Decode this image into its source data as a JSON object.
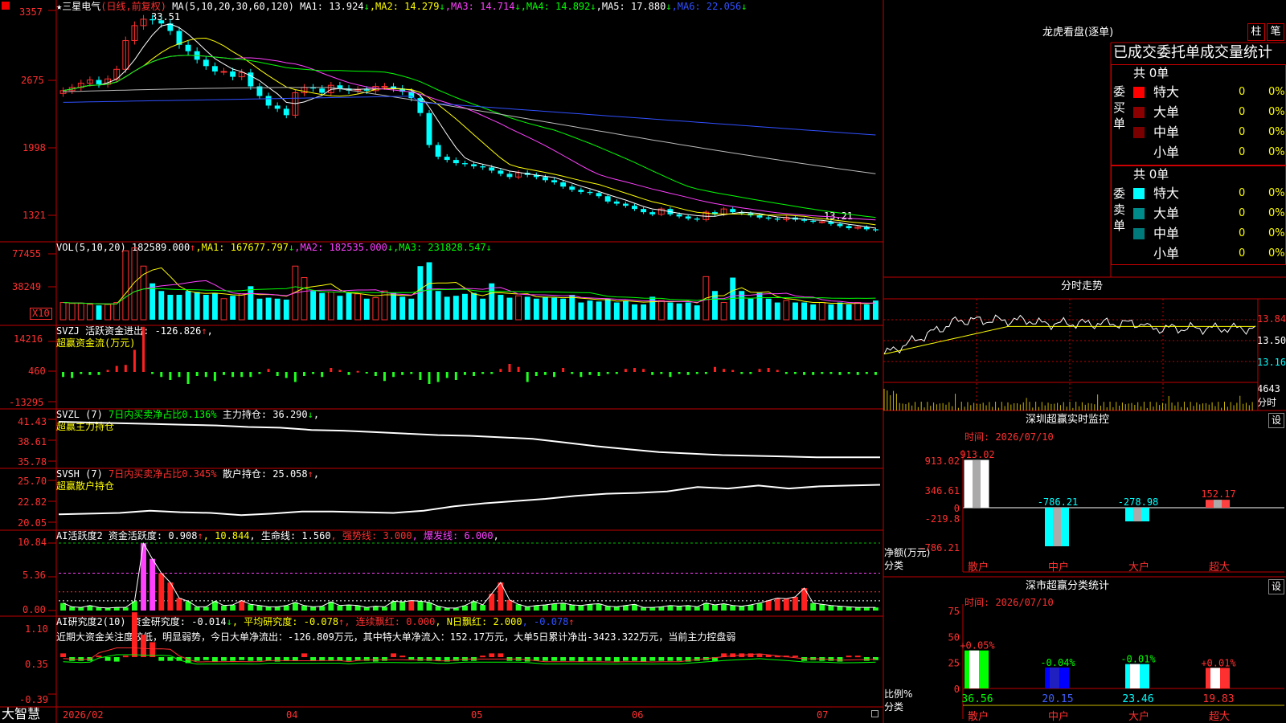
{
  "stock": {
    "name": "三星电气",
    "period": "日线",
    "adjust": "前复权",
    "high_label": "33.51",
    "low_label": "13.21"
  },
  "axis_labels": {
    "price": [
      "3357",
      "2675",
      "1998",
      "1321"
    ],
    "vol": [
      "77455",
      "38249"
    ],
    "vol_unit": "X10",
    "svzj": [
      "14216",
      "460",
      "-13295"
    ],
    "svzl": [
      "41.43",
      "38.61",
      "35.78"
    ],
    "svsh": [
      "25.70",
      "22.82",
      "20.05"
    ],
    "ai1": [
      "10.84",
      "5.36",
      "0.00"
    ],
    "ai2": [
      "1.10",
      "0.35",
      "-0.39"
    ]
  },
  "headers": {
    "price": [
      {
        "t": "★",
        "c": "#ffffff"
      },
      {
        "t": "三星电气",
        "c": "#ffffff"
      },
      {
        "t": "(日线,前复权)",
        "c": "#ff3030"
      },
      {
        "t": " MA(5,10,20,30,60,120) MA1: 13.924",
        "c": "#ffffff"
      },
      {
        "t": "↓",
        "c": "#00ff00"
      },
      {
        "t": ",MA2: 14.279",
        "c": "#ffff00"
      },
      {
        "t": "↓",
        "c": "#00ff00"
      },
      {
        "t": ",MA3: 14.714",
        "c": "#ff40ff"
      },
      {
        "t": "↓",
        "c": "#00ff00"
      },
      {
        "t": ",MA4: 14.892",
        "c": "#00ff00"
      },
      {
        "t": "↓",
        "c": "#00ff00"
      },
      {
        "t": ",MA5: 17.880",
        "c": "#ffffff"
      },
      {
        "t": "↓",
        "c": "#00ff00"
      },
      {
        "t": ",MA6: 22.056",
        "c": "#3050ff"
      },
      {
        "t": "↓",
        "c": "#00ff00"
      }
    ],
    "vol": [
      {
        "t": "VOL(5,10,20) 182589.000",
        "c": "#ffffff"
      },
      {
        "t": "↑",
        "c": "#ff3030"
      },
      {
        "t": ",MA1: 167677.797",
        "c": "#ffff00"
      },
      {
        "t": "↓",
        "c": "#00ff00"
      },
      {
        "t": ",MA2: 182535.000",
        "c": "#ff40ff"
      },
      {
        "t": "↓",
        "c": "#00ff00"
      },
      {
        "t": ",MA3: 231828.547",
        "c": "#00ff00"
      },
      {
        "t": "↓",
        "c": "#00ff00"
      }
    ],
    "svzj": [
      {
        "t": "SVZJ  活跃资金进出: -126.826",
        "c": "#ffffff"
      },
      {
        "t": "↑",
        "c": "#ff3030"
      },
      {
        "t": ",",
        "c": "#ffffff"
      }
    ],
    "svzj2": [
      {
        "t": "超赢资金流(万元)",
        "c": "#ffff00"
      }
    ],
    "svzl": [
      {
        "t": "SVZL (7) ",
        "c": "#ffffff"
      },
      {
        "t": "7日内买卖净占比0.136%",
        "c": "#00ff00"
      },
      {
        "t": " 主力持仓: 36.290",
        "c": "#ffffff"
      },
      {
        "t": "↓",
        "c": "#00ff00"
      },
      {
        "t": ",",
        "c": "#ffffff"
      }
    ],
    "svzl2": [
      {
        "t": "超赢主力持仓",
        "c": "#ffff00"
      }
    ],
    "svsh": [
      {
        "t": "SVSH (7) ",
        "c": "#ffffff"
      },
      {
        "t": "7日内买卖净占比0.345%",
        "c": "#ff3030"
      },
      {
        "t": " 散户持仓: 25.058",
        "c": "#ffffff"
      },
      {
        "t": "↑",
        "c": "#ff3030"
      },
      {
        "t": ",",
        "c": "#ffffff"
      }
    ],
    "svsh2": [
      {
        "t": "超赢散户持仓",
        "c": "#ffff00"
      }
    ],
    "ai1": [
      {
        "t": "AI活跃度2 资金活跃度: 0.908",
        "c": "#ffffff"
      },
      {
        "t": "↑",
        "c": "#ff3030"
      },
      {
        "t": ", 10.844",
        "c": "#ffff00"
      },
      {
        "t": ", 生命线: 1.560",
        "c": "#ffffff"
      },
      {
        "t": ", 强势线: 3.000",
        "c": "#ff3030"
      },
      {
        "t": ", 爆发线: 6.000",
        "c": "#ff40ff"
      },
      {
        "t": ",",
        "c": "#ffffff"
      }
    ],
    "ai2": [
      {
        "t": "AI研究度2(10) 资金研究度: -0.014",
        "c": "#ffffff"
      },
      {
        "t": "↓",
        "c": "#00ff00"
      },
      {
        "t": ", 平均研究度: -0.078",
        "c": "#ffff00"
      },
      {
        "t": "↑",
        "c": "#ff3030"
      },
      {
        "t": ", 连续飘红: 0.000",
        "c": "#ff3030"
      },
      {
        "t": ", N日飘红: 2.000",
        "c": "#ffff00"
      },
      {
        "t": ", -0.078",
        "c": "#3050ff"
      },
      {
        "t": "↑",
        "c": "#ff3030"
      }
    ],
    "ai2_text": "近期大资金关注度较低，明显弱势，今日大单净流出：-126.809万元，其中特大单净流入：152.17万元，大单5日累计净出-3423.322万元，当前主力控盘弱"
  },
  "bottom": {
    "brand": "大智慧",
    "dates": [
      "2026/02",
      "04",
      "05",
      "06",
      "07"
    ]
  },
  "longhu": {
    "title": "龙虎看盘(逐单)",
    "tab1": "柱",
    "tab2": "笔",
    "subtitle": "已成交委托单成交量统计",
    "buy": {
      "label": "委买单",
      "total": "共 0单",
      "rows": [
        {
          "name": "特大",
          "count": "0",
          "pct": "0%",
          "color": "#ff0000"
        },
        {
          "name": "大单",
          "count": "0",
          "pct": "0%",
          "color": "#8b0000"
        },
        {
          "name": "中单",
          "count": "0",
          "pct": "0%",
          "color": "#7a0000"
        },
        {
          "name": "小单",
          "count": "0",
          "pct": "0%",
          "color": ""
        }
      ]
    },
    "sell": {
      "label": "委卖单",
      "total": "共 0单",
      "rows": [
        {
          "name": "特大",
          "count": "0",
          "pct": "0%",
          "color": "#00ffff"
        },
        {
          "name": "大单",
          "count": "0",
          "pct": "0%",
          "color": "#008b8b"
        },
        {
          "name": "中单",
          "count": "0",
          "pct": "0%",
          "color": "#007a7a"
        },
        {
          "name": "小单",
          "count": "0",
          "pct": "0%",
          "color": ""
        }
      ]
    }
  },
  "intraday": {
    "title": "分时走势",
    "prices": [
      "13.84",
      "13.50",
      "13.16"
    ],
    "vol_label": "4643",
    "vol_unit": "分时"
  },
  "monitor": {
    "title": "深圳超赢实时监控",
    "set": "设",
    "time": "时间: 2026/07/10",
    "y_labels": [
      "913.02",
      "346.61",
      "0",
      "-219.8",
      "-786.21"
    ],
    "ylabel1": "净额(万元)",
    "ylabel2": "分类",
    "categories": [
      "散户",
      "中户",
      "大户",
      "超大"
    ],
    "values": [
      913.02,
      -786.21,
      -278.98,
      152.17
    ],
    "value_labels": [
      "913.02",
      "-786.21",
      "-278.98",
      "152.17"
    ]
  },
  "classify": {
    "title": "深市超赢分类统计",
    "set": "设",
    "time": "时间: 2026/07/10",
    "y_labels": [
      "75",
      "50",
      "25",
      "0"
    ],
    "ylabel1": "比例%",
    "ylabel2": "分类",
    "categories": [
      "散户",
      "中户",
      "大户",
      "超大"
    ],
    "values": [
      36.56,
      20.15,
      23.46,
      19.83
    ],
    "changes": [
      "+0.05%",
      "-0.04%",
      "-0.01%",
      "+0.01%"
    ]
  },
  "chart_data": [
    {
      "type": "candlestick",
      "title": "三星电气(日线,前复权)",
      "yticks": [
        3357,
        2675,
        1998,
        1321
      ],
      "x": [
        "2026/02",
        "04",
        "05",
        "06",
        "07"
      ],
      "close": [
        26.3,
        26.6,
        27.0,
        27.3,
        26.9,
        27.4,
        28.3,
        31.0,
        32.4,
        33.0,
        32.9,
        32.6,
        31.9,
        30.6,
        30.0,
        29.2,
        28.6,
        28.1,
        28.1,
        27.6,
        28.0,
        26.7,
        25.8,
        24.9,
        24.6,
        24.0,
        26.1,
        26.6,
        26.5,
        26.1,
        26.8,
        26.5,
        26.3,
        26.4,
        26.3,
        26.7,
        26.7,
        26.5,
        26.2,
        25.6,
        24.2,
        21.2,
        20.1,
        19.8,
        19.5,
        19.4,
        19.2,
        19.1,
        18.8,
        18.5,
        18.2,
        18.6,
        18.4,
        18.2,
        17.9,
        17.7,
        17.3,
        17.0,
        16.8,
        16.7,
        16.4,
        15.9,
        15.7,
        15.5,
        15.2,
        14.9,
        14.7,
        15.2,
        14.7,
        14.5,
        14.3,
        14.2,
        14.9,
        14.7,
        15.2,
        14.9,
        14.8,
        14.6,
        14.4,
        14.3,
        14.2,
        14.4,
        14.2,
        14.1,
        14.0,
        14.0,
        13.8,
        13.6,
        13.4,
        13.5,
        13.3,
        13.2
      ],
      "series": [
        {
          "name": "MA1",
          "color": "#ffffff"
        },
        {
          "name": "MA2",
          "color": "#ffff00"
        },
        {
          "name": "MA3",
          "color": "#ff40ff"
        },
        {
          "name": "MA4",
          "color": "#00ff00"
        },
        {
          "name": "MA5",
          "color": "#bbbbbb"
        },
        {
          "name": "MA6",
          "color": "#3050ff"
        }
      ]
    },
    {
      "type": "bar",
      "title": "VOL(5,10,20)",
      "yticks": [
        77455,
        38249
      ],
      "values": [
        18,
        17,
        17,
        16,
        15,
        16,
        18,
        72,
        75,
        56,
        38,
        30,
        26,
        26,
        30,
        29,
        26,
        28,
        22,
        25,
        27,
        35,
        22,
        23,
        22,
        21,
        56,
        44,
        30,
        28,
        29,
        25,
        28,
        27,
        22,
        23,
        30,
        28,
        24,
        22,
        56,
        60,
        30,
        24,
        25,
        27,
        28,
        22,
        38,
        26,
        23,
        25,
        24,
        22,
        24,
        23,
        22,
        26,
        18,
        20,
        19,
        22,
        18,
        20,
        16,
        16,
        24,
        20,
        18,
        17,
        18,
        15,
        45,
        30,
        18,
        44,
        30,
        22,
        28,
        22,
        18,
        20,
        18,
        18,
        16,
        18,
        16,
        18,
        16,
        18,
        16,
        20
      ]
    },
    {
      "type": "bar",
      "title": "SVZJ 活跃资金进出",
      "yticks": [
        14216,
        460,
        -13295
      ],
      "values": [
        -5,
        -6,
        -2,
        -3,
        -3,
        2,
        6,
        7,
        22,
        45,
        -2,
        -5,
        -8,
        -5,
        -12,
        -4,
        -5,
        -9,
        -3,
        -5,
        -5,
        -5,
        -2,
        3,
        -4,
        -6,
        -10,
        -4,
        -2,
        -5,
        4,
        2,
        -3,
        1,
        -1,
        -4,
        -9,
        -5,
        -3,
        -2,
        -8,
        -12,
        -10,
        -6,
        -8,
        -3,
        -4,
        -2,
        -2,
        3,
        8,
        5,
        -10,
        -4,
        -3,
        -5,
        4,
        -2,
        -5,
        -3,
        -4,
        -2,
        -2,
        3,
        4,
        3,
        -3,
        -2,
        -5,
        -2,
        -3,
        -2,
        -2,
        5,
        3,
        2,
        -2,
        -2,
        3,
        4,
        2,
        -2,
        -2,
        -3,
        -3,
        -2,
        -2,
        -3,
        -2,
        -3,
        -2,
        -3
      ]
    },
    {
      "type": "line",
      "title": "SVZL 主力持仓",
      "yticks": [
        41.43,
        38.61,
        35.78
      ],
      "values": [
        41.1,
        41.0,
        40.9,
        40.8,
        40.7,
        40.6,
        40.4,
        40.3,
        40.0,
        39.9,
        39.7,
        39.5,
        39.3,
        39.2,
        39.0,
        38.8,
        38.3,
        37.8,
        37.4,
        37.0,
        36.8,
        36.6,
        36.5,
        36.4,
        36.3,
        36.3,
        36.3
      ]
    },
    {
      "type": "line",
      "title": "SVSH 散户持仓",
      "yticks": [
        25.7,
        22.82,
        20.05
      ],
      "values": [
        21.1,
        21.2,
        21.3,
        21.6,
        21.4,
        21.3,
        21.0,
        21.2,
        21.5,
        21.5,
        21.4,
        21.3,
        21.6,
        22.2,
        22.6,
        22.9,
        23.2,
        23.6,
        23.9,
        24.0,
        24.2,
        24.8,
        24.6,
        25.0,
        24.6,
        24.9,
        25.0,
        25.1
      ]
    },
    {
      "type": "bar",
      "title": "AI活跃度2",
      "yticks": [
        10.84,
        5.36,
        0.0
      ],
      "values": [
        1.2,
        0.6,
        0.5,
        0.8,
        0.5,
        0.4,
        0.5,
        0.5,
        1.5,
        10.8,
        8.3,
        6.0,
        4.5,
        2.0,
        1.5,
        0.6,
        0.6,
        1.5,
        0.8,
        0.9,
        1.6,
        1.0,
        0.8,
        0.6,
        0.6,
        0.8,
        1.3,
        0.8,
        0.6,
        0.7,
        1.4,
        0.8,
        0.9,
        0.8,
        0.5,
        0.7,
        0.6,
        1.5,
        1.4,
        1.6,
        1.5,
        1.3,
        0.7,
        0.4,
        0.4,
        0.8,
        1.5,
        0.9,
        2.7,
        4.5,
        1.7,
        1.0,
        0.6,
        0.8,
        0.9,
        1.1,
        1.2,
        0.9,
        0.8,
        1.0,
        1.1,
        0.7,
        0.6,
        0.8,
        1.0,
        0.5,
        0.5,
        0.6,
        0.8,
        0.7,
        0.8,
        0.6,
        1.2,
        0.9,
        1.1,
        0.8,
        0.7,
        0.9,
        1.2,
        1.6,
        2.0,
        1.9,
        2.2,
        3.6,
        1.2,
        1.0,
        0.8,
        0.7,
        0.6,
        0.5,
        0.5,
        0.5
      ],
      "ref_lines": [
        {
          "name": "生命线",
          "value": 1.56
        },
        {
          "name": "强势线",
          "value": 3.0
        },
        {
          "name": "爆发线",
          "value": 6.0
        }
      ]
    },
    {
      "type": "bar",
      "title": "AI研究度2(10)",
      "yticks": [
        1.1,
        0.35,
        -0.39
      ],
      "values": [
        0.05,
        -0.05,
        -0.05,
        -0.05,
        0.02,
        -0.05,
        -0.06,
        0.02,
        0.6,
        0.3,
        0.2,
        -0.05,
        -0.05,
        -0.05,
        -0.08,
        -0.05,
        -0.04,
        -0.06,
        -0.05,
        -0.05,
        -0.04,
        -0.05,
        -0.05,
        -0.05,
        -0.06,
        -0.05,
        -0.05,
        0.05,
        -0.05,
        -0.05,
        -0.05,
        -0.05,
        -0.05,
        -0.04,
        -0.05,
        -0.06,
        -0.05,
        0.05,
        0.02,
        -0.03,
        -0.05,
        -0.05,
        -0.05,
        -0.06,
        -0.05,
        -0.05,
        -0.05,
        0.02,
        0.05,
        0.05,
        -0.05,
        -0.05,
        -0.06,
        -0.05,
        -0.05,
        -0.05,
        -0.05,
        -0.05,
        -0.06,
        -0.05,
        -0.05,
        -0.05,
        -0.06,
        -0.05,
        -0.05,
        -0.06,
        -0.05,
        -0.05,
        -0.05,
        -0.05,
        -0.06,
        -0.05,
        -0.04,
        -0.05,
        0.05,
        0.05,
        0.05,
        0.05,
        0.04,
        0.03,
        0.02,
        0.02,
        0.02,
        -0.05,
        -0.04,
        -0.05,
        -0.05,
        -0.06,
        0.02,
        0.02,
        -0.05,
        -0.04
      ]
    }
  ]
}
